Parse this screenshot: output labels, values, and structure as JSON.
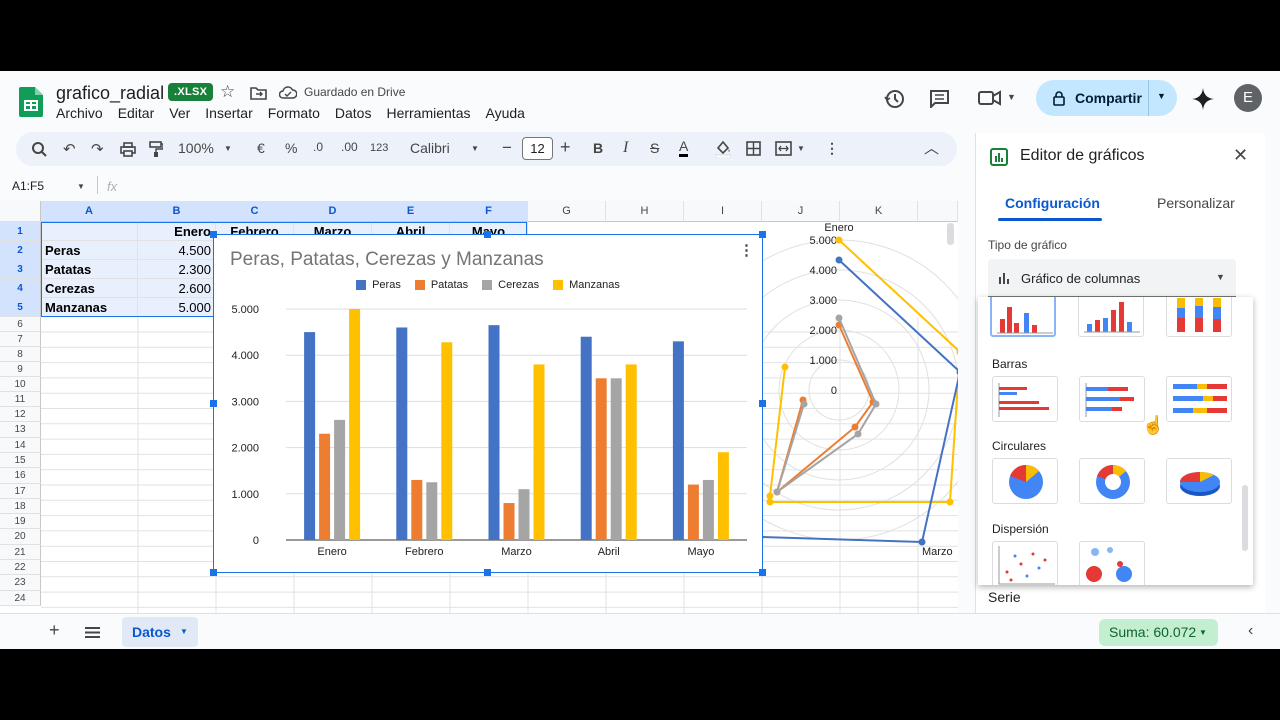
{
  "header": {
    "title": "grafico_radial",
    "file_badge": ".XLSX",
    "saved_status": "Guardado en Drive",
    "share_label": "Compartir",
    "avatar_letter": "E"
  },
  "menu": [
    "Archivo",
    "Editar",
    "Ver",
    "Insertar",
    "Formato",
    "Datos",
    "Herramientas",
    "Ayuda"
  ],
  "toolbar": {
    "zoom": "100%",
    "currency": "€",
    "percent": "%",
    "dec_dec": ".0",
    "inc_dec": ".00",
    "number_format": "123",
    "font": "Calibri",
    "font_size": "12",
    "bold": "B",
    "italic": "I",
    "strikethrough": "S",
    "text_color": "A"
  },
  "formula_bar": {
    "name_box": "A1:F5",
    "fx": "fx"
  },
  "columns": [
    "A",
    "B",
    "C",
    "D",
    "E",
    "F",
    "G",
    "H",
    "I",
    "J",
    "K"
  ],
  "rows": [
    "1",
    "2",
    "3",
    "4",
    "5",
    "6",
    "7",
    "8",
    "9",
    "10",
    "11",
    "12",
    "13",
    "14",
    "15",
    "16",
    "17",
    "18",
    "19",
    "20",
    "21",
    "22",
    "23",
    "24"
  ],
  "cells": {
    "header_row": [
      "",
      "Enero",
      "Febrero",
      "Marzo",
      "Abril",
      "Mayo"
    ],
    "labels": [
      "Peras",
      "Patatas",
      "Cerezas",
      "Manzanas"
    ],
    "b_values": [
      "4.500",
      "2.300",
      "2.600",
      "5.000"
    ]
  },
  "chart_data": [
    {
      "type": "bar",
      "title": "Peras, Patatas, Cerezas y Manzanas",
      "categories": [
        "Enero",
        "Febrero",
        "Marzo",
        "Abril",
        "Mayo"
      ],
      "series": [
        {
          "name": "Peras",
          "color": "#4472c4",
          "values": [
            4500,
            4600,
            4650,
            4400,
            4300
          ]
        },
        {
          "name": "Patatas",
          "color": "#ed7d31",
          "values": [
            2300,
            1300,
            800,
            3500,
            1200
          ]
        },
        {
          "name": "Cerezas",
          "color": "#a5a5a5",
          "values": [
            2600,
            1250,
            1100,
            3500,
            1300
          ]
        },
        {
          "name": "Manzanas",
          "color": "#ffc000",
          "values": [
            5000,
            4280,
            3800,
            3800,
            1900
          ]
        }
      ],
      "ylim": [
        0,
        5000
      ],
      "yticks": [
        "0",
        "1.000",
        "2.000",
        "3.000",
        "4.000",
        "5.000"
      ],
      "legend": "top",
      "grid": true
    },
    {
      "type": "radar",
      "categories": [
        "Enero",
        "Marzo"
      ],
      "radial_ticks": [
        "0",
        "1.000",
        "2.000",
        "3.000",
        "4.000",
        "5.000"
      ]
    }
  ],
  "sidebar": {
    "title": "Editor de gráficos",
    "tab_config": "Configuración",
    "tab_custom": "Personalizar",
    "type_label": "Tipo de gráfico",
    "type_value": "Gráfico de columnas",
    "groups": [
      "Barras",
      "Circulares",
      "Dispersión"
    ],
    "serie_label": "Serie"
  },
  "bottom": {
    "sheet": "Datos",
    "sum": "Suma: 60.072"
  },
  "colors": {
    "accent": "#1a73e8",
    "share_bg": "#c2e7ff",
    "sum_bg": "#c4eed0"
  }
}
